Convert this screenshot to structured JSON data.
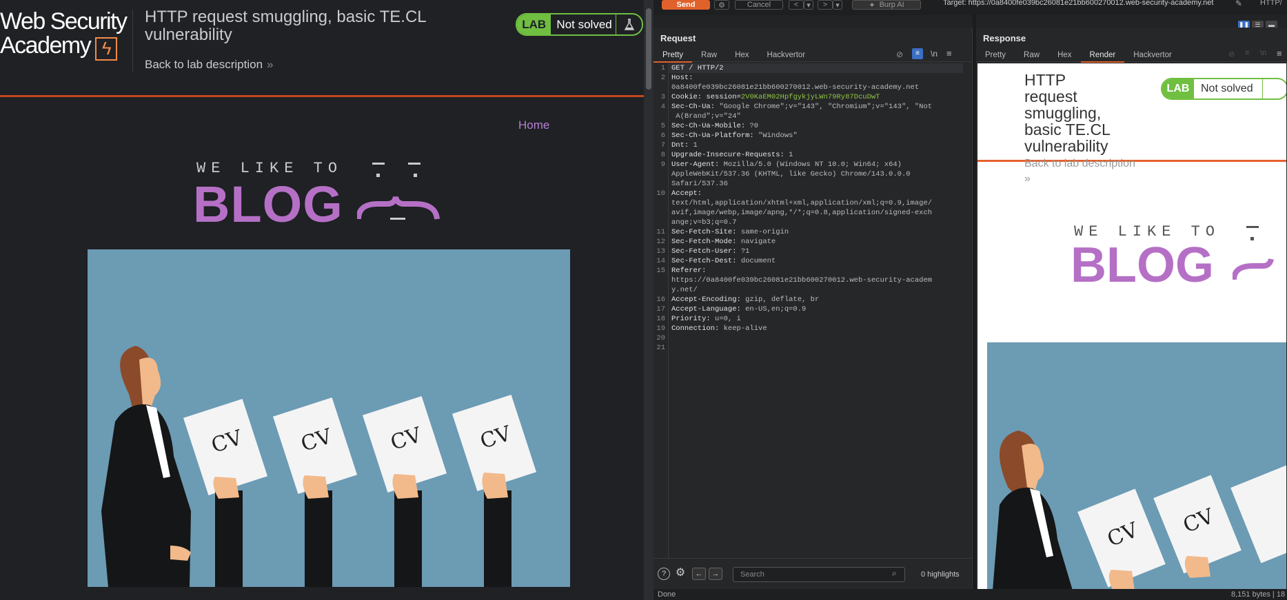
{
  "left": {
    "logo_line1": "Web Security",
    "logo_line2": "Academy",
    "lab_title": "HTTP request smuggling, basic TE.CL vulnerability",
    "back_link": "Back to lab description",
    "lab_label": "LAB",
    "lab_status": "Not solved",
    "home_link": "Home",
    "blog_small": "WE LIKE TO",
    "blog_big": "BLOG",
    "cv_label": "CV"
  },
  "burp": {
    "send": "Send",
    "cancel": "Cancel",
    "burp_ai": "Burp AI",
    "target": "Target: https://0a8400fe039bc26081e21bb600270012.web-security-academy.net",
    "http_label": "HTTP/",
    "request": {
      "title": "Request",
      "tabs": [
        "Pretty",
        "Raw",
        "Hex",
        "Hackvertor"
      ],
      "lines": [
        {
          "n": "1",
          "parts": [
            [
              "hn",
              "GET / HTTP/2"
            ]
          ]
        },
        {
          "n": "2",
          "parts": [
            [
              "hn",
              "Host:"
            ]
          ]
        },
        {
          "n": "",
          "parts": [
            [
              "hv",
              "0a8400fe039bc26081e21bb600270012.web-security-academy.net"
            ]
          ]
        },
        {
          "n": "3",
          "parts": [
            [
              "hn",
              "Cookie: "
            ],
            [
              "hn",
              "session="
            ],
            [
              "hg",
              "2V0KaEM02HpfgykjyLWn79Ry87DcuDwT"
            ]
          ]
        },
        {
          "n": "4",
          "parts": [
            [
              "hn",
              "Sec-Ch-Ua: "
            ],
            [
              "hv",
              "\"Google Chrome\";v=\"143\", \"Chromium\";v=\"143\", \"Not"
            ]
          ]
        },
        {
          "n": "",
          "parts": [
            [
              "hv",
              " A(Brand\";v=\"24\""
            ]
          ]
        },
        {
          "n": "5",
          "parts": [
            [
              "hn",
              "Sec-Ch-Ua-Mobile: "
            ],
            [
              "hv",
              "?0"
            ]
          ]
        },
        {
          "n": "6",
          "parts": [
            [
              "hn",
              "Sec-Ch-Ua-Platform: "
            ],
            [
              "hv",
              "\"Windows\""
            ]
          ]
        },
        {
          "n": "7",
          "parts": [
            [
              "hn",
              "Dnt: "
            ],
            [
              "hv",
              "1"
            ]
          ]
        },
        {
          "n": "8",
          "parts": [
            [
              "hn",
              "Upgrade-Insecure-Requests: "
            ],
            [
              "hv",
              "1"
            ]
          ]
        },
        {
          "n": "9",
          "parts": [
            [
              "hn",
              "User-Agent: "
            ],
            [
              "hv",
              "Mozilla/5.0 (Windows NT 10.0; Win64; x64)"
            ]
          ]
        },
        {
          "n": "",
          "parts": [
            [
              "hv",
              "AppleWebKit/537.36 (KHTML, like Gecko) Chrome/143.0.0.0"
            ]
          ]
        },
        {
          "n": "",
          "parts": [
            [
              "hv",
              "Safari/537.36"
            ]
          ]
        },
        {
          "n": "10",
          "parts": [
            [
              "hn",
              "Accept:"
            ]
          ]
        },
        {
          "n": "",
          "parts": [
            [
              "hv",
              "text/html,application/xhtml+xml,application/xml;q=0.9,image/"
            ]
          ]
        },
        {
          "n": "",
          "parts": [
            [
              "hv",
              "avif,image/webp,image/apng,*/*;q=0.8,application/signed-exch"
            ]
          ]
        },
        {
          "n": "",
          "parts": [
            [
              "hv",
              "ange;v=b3;q=0.7"
            ]
          ]
        },
        {
          "n": "11",
          "parts": [
            [
              "hn",
              "Sec-Fetch-Site: "
            ],
            [
              "hv",
              "same-origin"
            ]
          ]
        },
        {
          "n": "12",
          "parts": [
            [
              "hn",
              "Sec-Fetch-Mode: "
            ],
            [
              "hv",
              "navigate"
            ]
          ]
        },
        {
          "n": "13",
          "parts": [
            [
              "hn",
              "Sec-Fetch-User: "
            ],
            [
              "hv",
              "?1"
            ]
          ]
        },
        {
          "n": "14",
          "parts": [
            [
              "hn",
              "Sec-Fetch-Dest: "
            ],
            [
              "hv",
              "document"
            ]
          ]
        },
        {
          "n": "15",
          "parts": [
            [
              "hn",
              "Referer:"
            ]
          ]
        },
        {
          "n": "",
          "parts": [
            [
              "hv",
              "https://0a8400fe039bc26081e21bb600270012.web-security-academ"
            ]
          ]
        },
        {
          "n": "",
          "parts": [
            [
              "hv",
              "y.net/"
            ]
          ]
        },
        {
          "n": "16",
          "parts": [
            [
              "hn",
              "Accept-Encoding: "
            ],
            [
              "hv",
              "gzip, deflate, br"
            ]
          ]
        },
        {
          "n": "17",
          "parts": [
            [
              "hn",
              "Accept-Language: "
            ],
            [
              "hv",
              "en-US,en;q=0.9"
            ]
          ]
        },
        {
          "n": "18",
          "parts": [
            [
              "hn",
              "Priority: "
            ],
            [
              "hv",
              "u=0, i"
            ]
          ]
        },
        {
          "n": "19",
          "parts": [
            [
              "hn",
              "Connection: "
            ],
            [
              "hv",
              "keep-alive"
            ]
          ]
        },
        {
          "n": "20",
          "parts": []
        },
        {
          "n": "21",
          "parts": []
        }
      ],
      "search_placeholder": "Search",
      "highlights": "0 highlights"
    },
    "response": {
      "title": "Response",
      "tabs": [
        "Pretty",
        "Raw",
        "Hex",
        "Render",
        "Hackvertor"
      ],
      "active_tab": "Render",
      "render": {
        "lab_title": "HTTP request smuggling, basic TE.CL vulnerability",
        "lab_label": "LAB",
        "lab_status": "Not solved",
        "back_link": "Back to lab description",
        "back_chev": "»",
        "blog_small": "WE LIKE TO",
        "blog_big": "BLOG",
        "cv_label": "CV"
      }
    },
    "status_left": "Done",
    "status_right": "8,151 bytes | 18"
  }
}
